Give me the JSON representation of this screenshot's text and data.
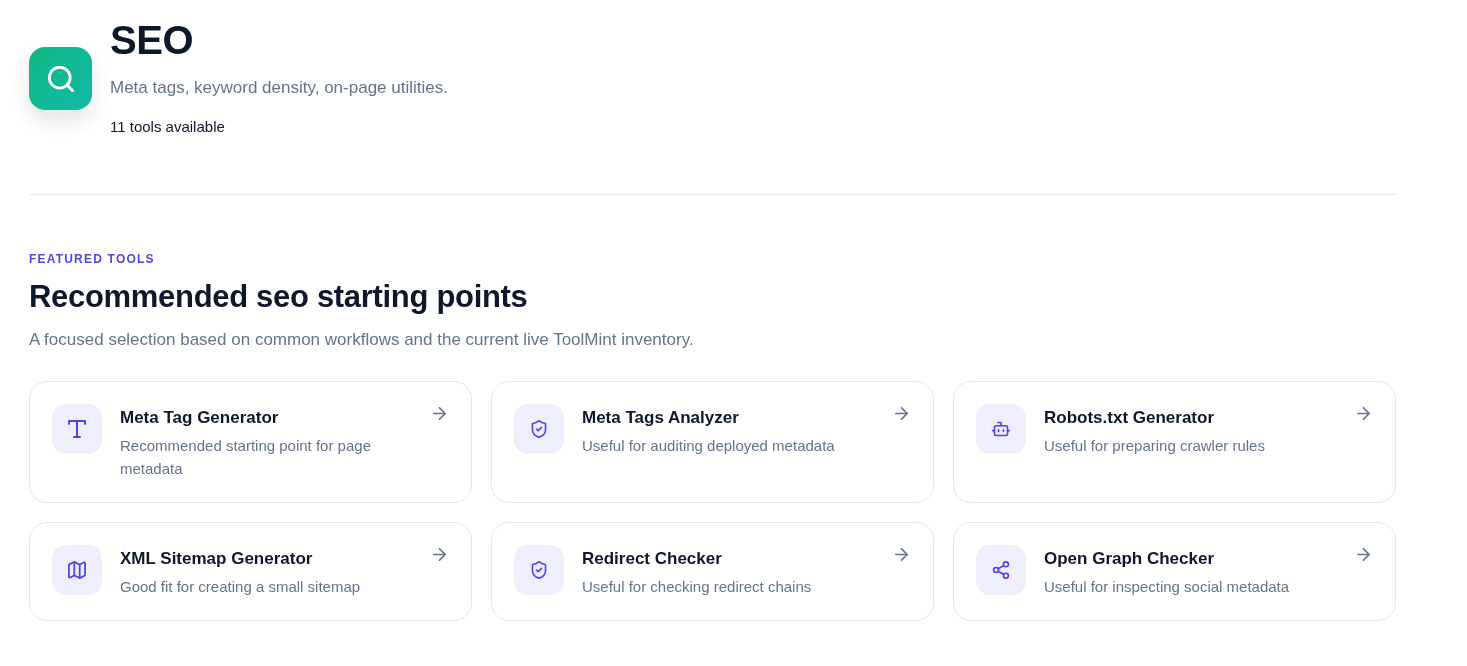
{
  "header": {
    "title": "SEO",
    "subtitle": "Meta tags, keyword density, on-page utilities.",
    "count": "11 tools available"
  },
  "featured": {
    "eyebrow": "FEATURED TOOLS",
    "heading": "Recommended seo starting points",
    "description": "A focused selection based on common workflows and the current live ToolMint inventory."
  },
  "tools": [
    {
      "kind": "text",
      "title": "Meta Tag Generator",
      "description": "Recommended starting point for page metadata"
    },
    {
      "kind": "shield",
      "title": "Meta Tags Analyzer",
      "description": "Useful for auditing deployed metadata"
    },
    {
      "kind": "robot",
      "title": "Robots.txt Generator",
      "description": "Useful for preparing crawler rules"
    },
    {
      "kind": "map",
      "title": "XML Sitemap Generator",
      "description": "Good fit for creating a small sitemap"
    },
    {
      "kind": "shield",
      "title": "Redirect Checker",
      "description": "Useful for checking redirect chains"
    },
    {
      "kind": "share",
      "title": "Open Graph Checker",
      "description": "Useful for inspecting social metadata"
    }
  ]
}
